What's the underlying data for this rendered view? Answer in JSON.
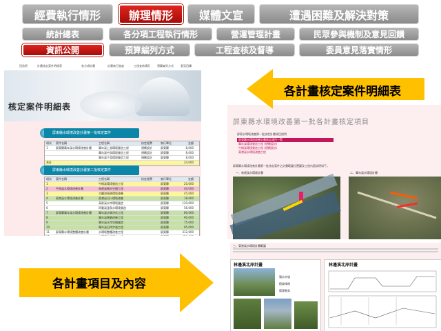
{
  "top_tabs": [
    "經費執行情形",
    "辦理情形",
    "媒體文宣",
    "遭遇困難及解決對策"
  ],
  "active_top_tab": "辦理情形",
  "sub_tabs_row1": [
    "統計總表",
    "各分項工程執行情形",
    "營運管理計畫",
    "民眾參與機制及意見回饋"
  ],
  "sub_tabs_row2": [
    "資訊公開",
    "預算編列方式",
    "工程查核及督導",
    "委員意見落實情形"
  ],
  "active_sub_tab": "資訊公開",
  "left_panel": {
    "nav_items": [
      "回首頁",
      "計畫核定案件明細表",
      "各分項計畫",
      "計畫執行進度",
      "工程查核情形",
      "預算編列方式",
      "意見回饋"
    ],
    "banner_title": "核定案件明細表",
    "section1_title": "屏東縣水環境改善計畫第一批核定案件",
    "section2_title": "屏東縣水環境改善計畫第二批核定案件",
    "table_header": [
      "項次",
      "案件名稱",
      "工程名稱",
      "核定經費",
      "執行單位",
      "金額"
    ],
    "table1_rows": [
      [
        "1",
        "屏東縣萬年溪水環境改善計畫",
        "萬年溪上游環境營造工程",
        "規劃設計",
        "屏東縣",
        "8,000"
      ],
      [
        "",
        "",
        "萬年溪中游環境營造工程",
        "規劃設計",
        "屏東縣",
        "8,000"
      ],
      [
        "",
        "",
        "萬年溪下游環境營造工程",
        "規劃設計",
        "屏東縣",
        "8,000"
      ],
      [
        "合計",
        "",
        "",
        "",
        "",
        "24,000"
      ]
    ],
    "table2_rows": [
      [
        "1",
        "",
        "牛稠溪環境營造工程",
        "",
        "屏東縣",
        "20,000"
      ],
      [
        "2",
        "牛稠溪水環境改善計畫",
        "林邊溪親水空間工程",
        "",
        "屏東縣",
        "40,000"
      ],
      [
        "3",
        "",
        "大鵬灣周邊環境改善",
        "",
        "屏東縣",
        "45,000"
      ],
      [
        "4",
        "東港溪水環境改善計畫",
        "東港溪河川環境改善",
        "",
        "屏東縣",
        "18,000"
      ],
      [
        "5",
        "",
        "高屏溪水岸環境營造",
        "",
        "屏東縣",
        "120,000"
      ],
      [
        "6",
        "",
        "四重溪溫泉水環境營造",
        "",
        "屏東縣",
        "56,000"
      ],
      [
        "7",
        "屏東縣萬年溪水環境改善計畫",
        "萬年溪水質淨化工程",
        "",
        "屏東縣",
        "80,000"
      ],
      [
        "8",
        "",
        "萬年溪景觀改善工程",
        "",
        "屏東縣",
        "90,000"
      ],
      [
        "9",
        "",
        "萬年溪水岸空間營造",
        "",
        "屏東縣",
        "75,000"
      ],
      [
        "10",
        "",
        "萬年溪沿岸步道工程",
        "",
        "屏東縣",
        "65,000"
      ],
      [
        "11",
        "屏東縣水環境整體改善計畫",
        "水環境整體改善工程",
        "",
        "屏東縣",
        "312,000"
      ],
      [
        "12",
        "",
        "水環境生態復育工程",
        "",
        "屏東縣",
        "450,000"
      ],
      [
        "合計",
        "",
        "",
        "",
        "",
        "1,240,000"
      ]
    ]
  },
  "right_panel": {
    "doc_title": "屏東縣水環境改善第一批各計畫核定項目",
    "intro_text": "屏東水環境改善第一批核定計畫項目說明",
    "list_items": [
      "屏東縣水環境改善計畫核定項目一覽",
      "萬年溪環境營造工程 (規劃設計)",
      "牛稠溪環境營造工程 (規劃設計)",
      "東港溪水環境改善工程"
    ],
    "body_text": "屏東縣水環境改善計畫第一批核定案件之計畫範圍位置圖及工程內容說明如下。",
    "map1_caption": "一、林邊溪水環境計畫",
    "map2_caption": "二、萬年溪水環境計畫",
    "lower_caption": "三、東港溪水環境計畫範圍",
    "photo1_title": "林邊溪北岸計畫",
    "photo2_title": "林邊溪北岸計畫",
    "photo_side_labels": [
      "親水步道",
      "植栽綠帶",
      "環境教育"
    ]
  },
  "callouts": {
    "upper": "各計畫核定案件明細表",
    "lower": "各計畫項目及內容"
  },
  "colors": {
    "active_tab": "#c8160f",
    "inactive_tab": "#9e9e9e",
    "arrow": "#ffc000",
    "section_header": "#0b86a8",
    "table_yellow": "#fff59d",
    "table_green": "#c5e1a5",
    "table_pink": "#f8bbd0",
    "left_panel_bg": "#fdeaea",
    "right_panel_bg": "#fdeef0"
  }
}
